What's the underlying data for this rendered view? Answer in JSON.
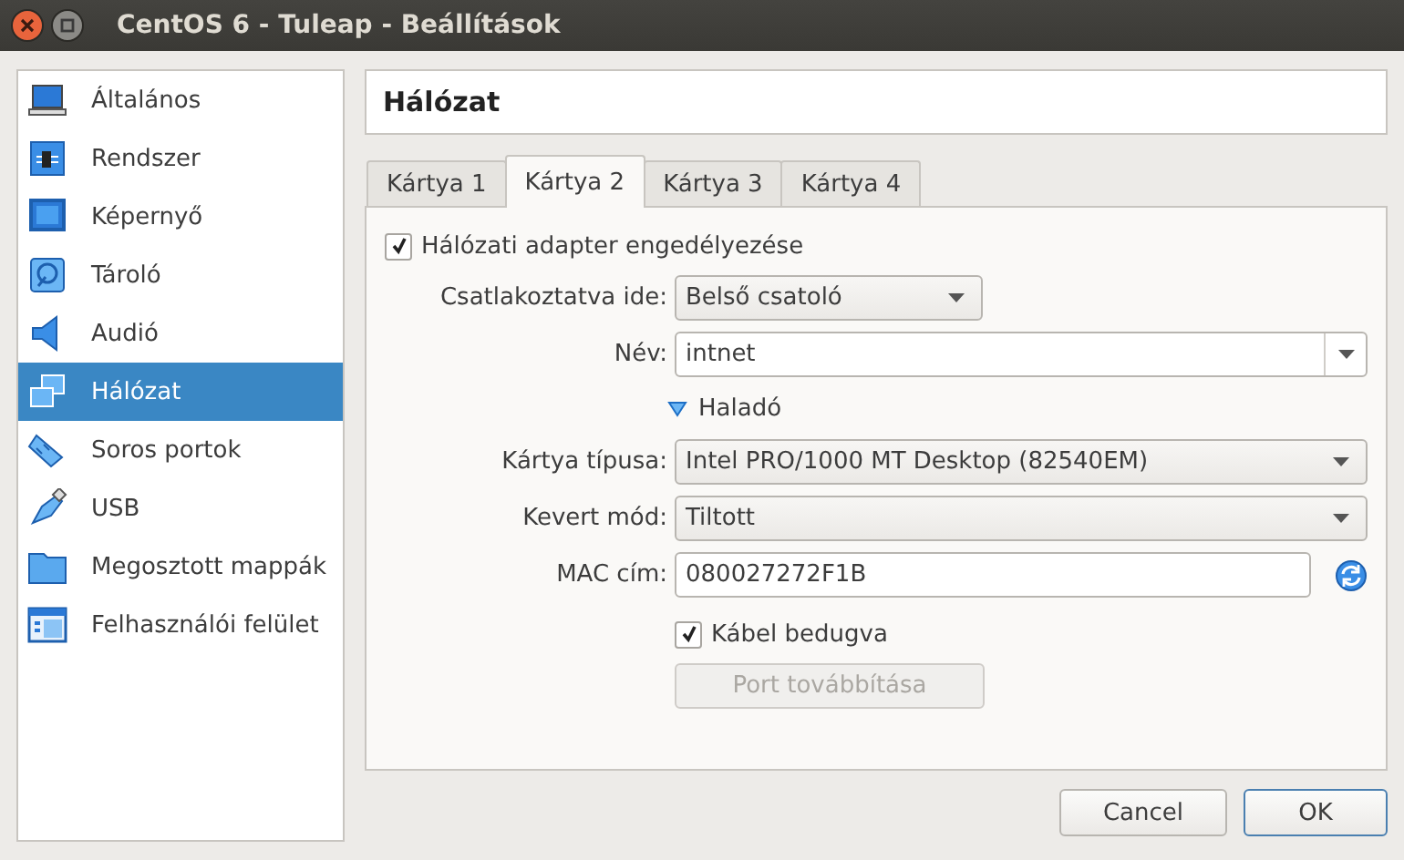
{
  "window": {
    "title": "CentOS 6 - Tuleap - Beállítások"
  },
  "sidebar": {
    "items": [
      {
        "label": "Általános",
        "kind": "general",
        "selected": false
      },
      {
        "label": "Rendszer",
        "kind": "system",
        "selected": false
      },
      {
        "label": "Képernyő",
        "kind": "display",
        "selected": false
      },
      {
        "label": "Tároló",
        "kind": "storage",
        "selected": false
      },
      {
        "label": "Audió",
        "kind": "audio",
        "selected": false
      },
      {
        "label": "Hálózat",
        "kind": "network",
        "selected": true
      },
      {
        "label": "Soros portok",
        "kind": "serial",
        "selected": false
      },
      {
        "label": "USB",
        "kind": "usb",
        "selected": false
      },
      {
        "label": "Megosztott mappák",
        "kind": "folder",
        "selected": false
      },
      {
        "label": "Felhasználói felület",
        "kind": "ui",
        "selected": false
      }
    ]
  },
  "page_title": "Hálózat",
  "tabs": [
    {
      "label": "Kártya 1",
      "selected": false
    },
    {
      "label": "Kártya 2",
      "selected": true
    },
    {
      "label": "Kártya 3",
      "selected": false
    },
    {
      "label": "Kártya 4",
      "selected": false
    }
  ],
  "form": {
    "enable": {
      "label": "Hálózati adapter engedélyezése",
      "checked": true
    },
    "attached": {
      "label": "Csatlakoztatva ide:",
      "value": "Belső csatoló"
    },
    "name": {
      "label": "Név:",
      "value": "intnet"
    },
    "advanced": {
      "label": "Haladó",
      "expanded": true
    },
    "adapter_type": {
      "label": "Kártya típusa:",
      "value": "Intel PRO/1000 MT Desktop (82540EM)"
    },
    "promiscuous": {
      "label": "Kevert mód:",
      "value": "Tiltott"
    },
    "mac": {
      "label": "MAC cím:",
      "value": "080027272F1B"
    },
    "cable": {
      "label": "Kábel bedugva",
      "checked": true
    },
    "port_forwarding": {
      "label": "Port továbbítása",
      "disabled": true
    }
  },
  "buttons": [
    {
      "label": "Cancel",
      "default": false
    },
    {
      "label": "OK",
      "default": true
    }
  ]
}
